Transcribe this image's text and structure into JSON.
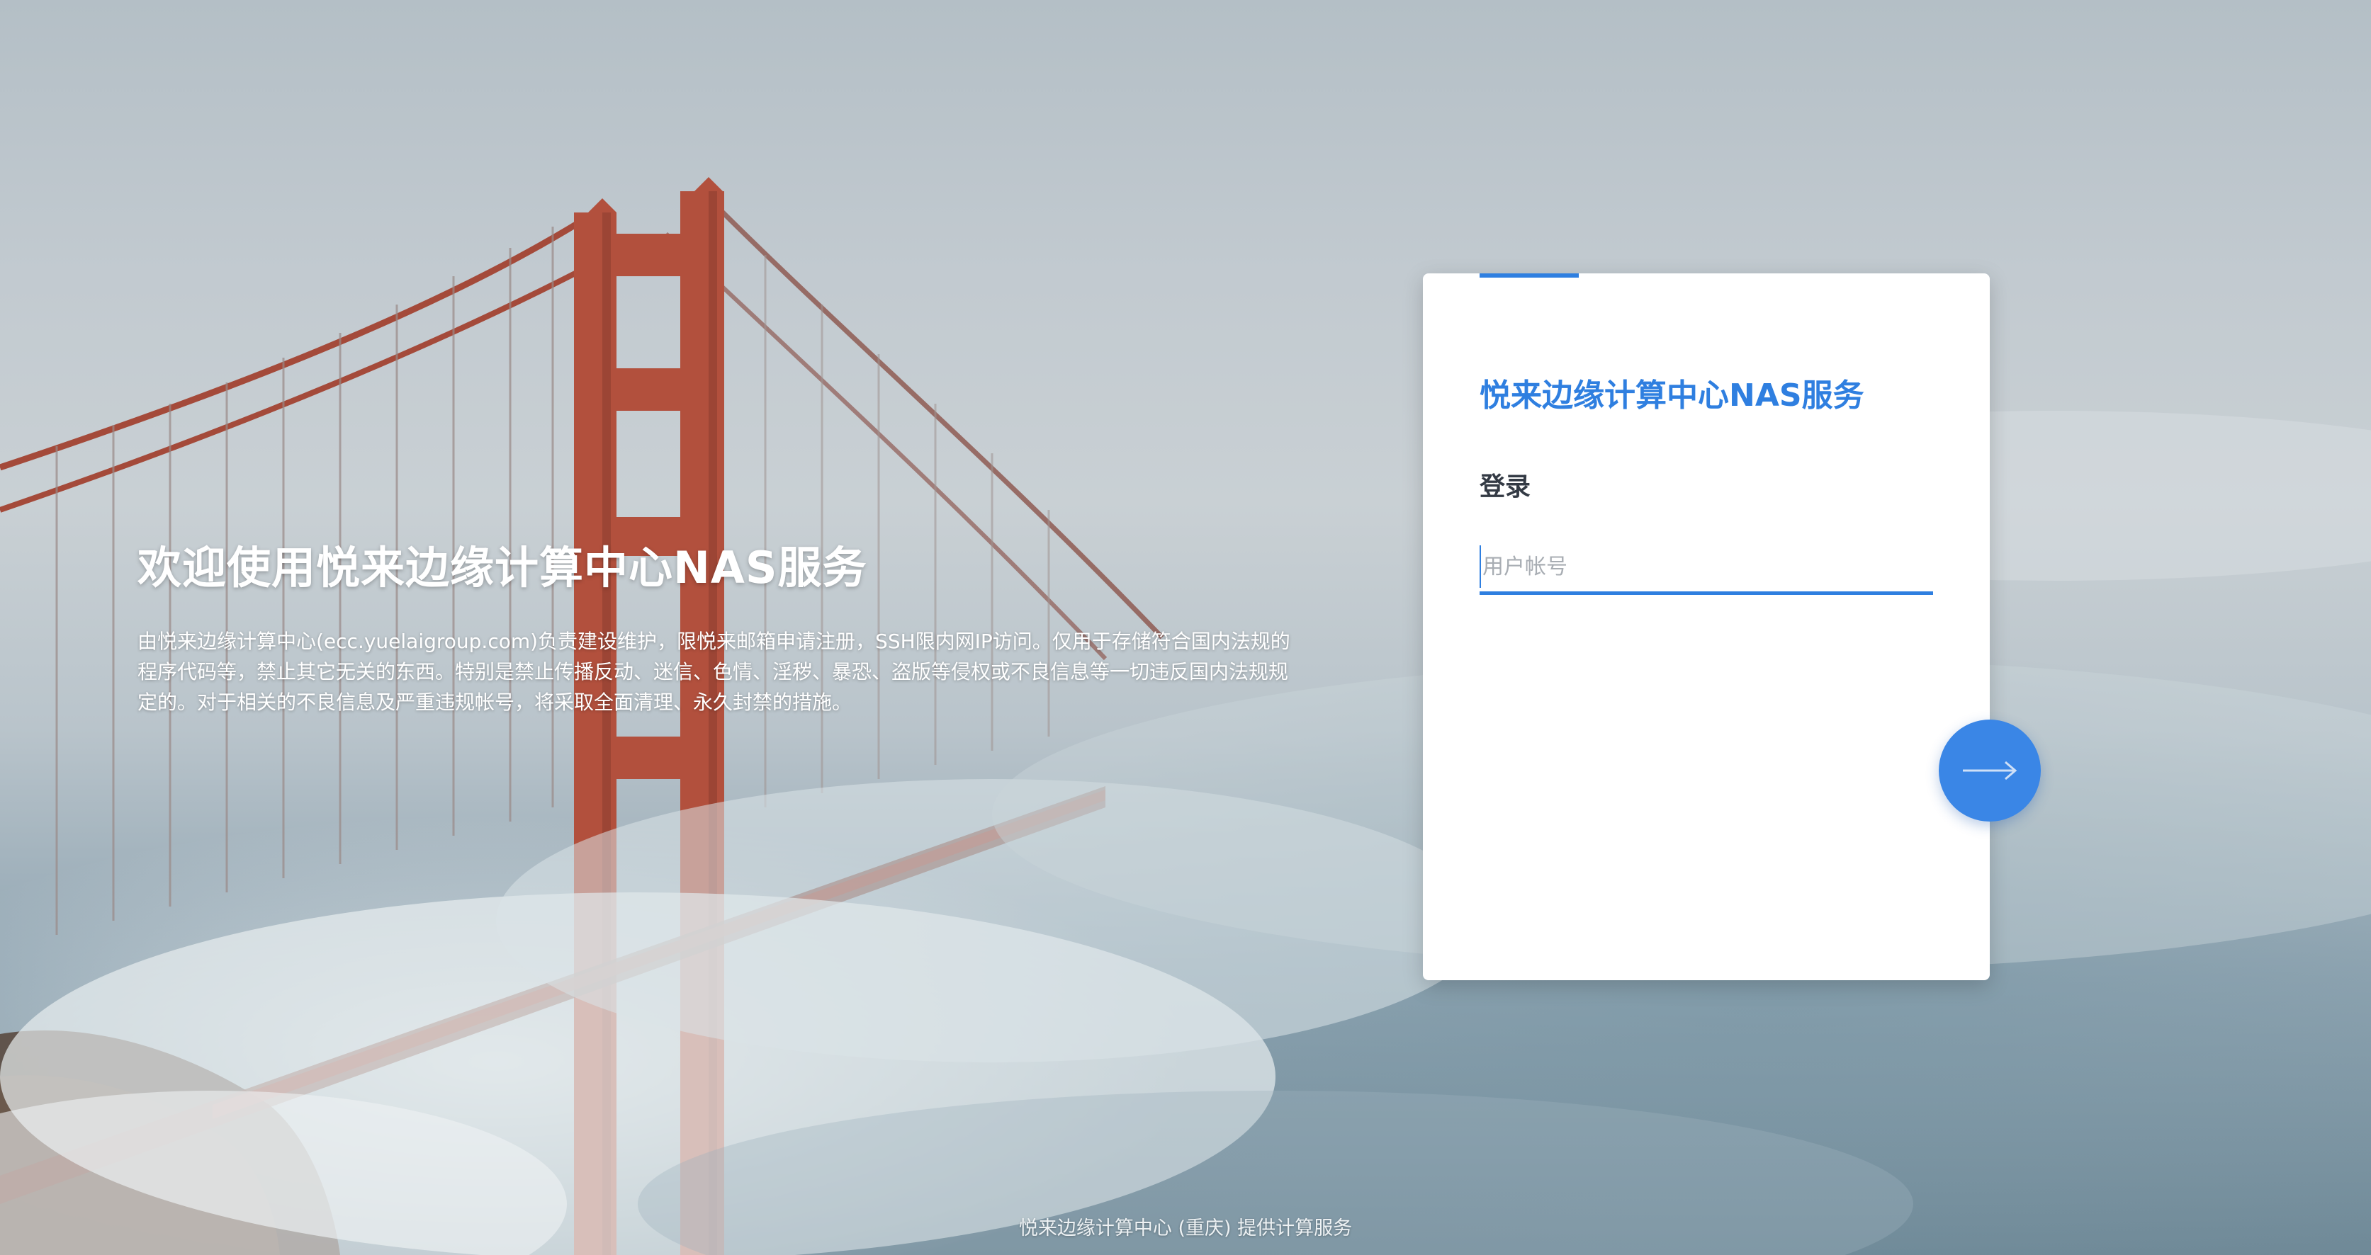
{
  "welcome": {
    "title": "欢迎使用悦来边缘计算中心NAS服务",
    "description": "由悦来边缘计算中心(ecc.yuelaigroup.com)负责建设维护，限悦来邮箱申请注册，SSH限内网IP访问。仅用于存储符合国内法规的程序代码等，禁止其它无关的东西。特别是禁止传播反动、迷信、色情、淫秽、暴恐、盗版等侵权或不良信息等一切违反国内法规规定的。对于相关的不良信息及严重违规帐号，将采取全面清理、永久封禁的措施。"
  },
  "login_card": {
    "brand_title": "悦来边缘计算中心NAS服务",
    "heading": "登录",
    "username_placeholder": "用户帐号",
    "username_value": "",
    "submit_icon": "arrow-right-icon"
  },
  "footer": {
    "text": "悦来边缘计算中心 (重庆) 提供计算服务"
  },
  "colors": {
    "accent": "#2f7fe0",
    "button": "#3a86e6",
    "card_background": "#ffffff",
    "heading_text": "#333a44",
    "placeholder_text": "#a8adb3"
  }
}
